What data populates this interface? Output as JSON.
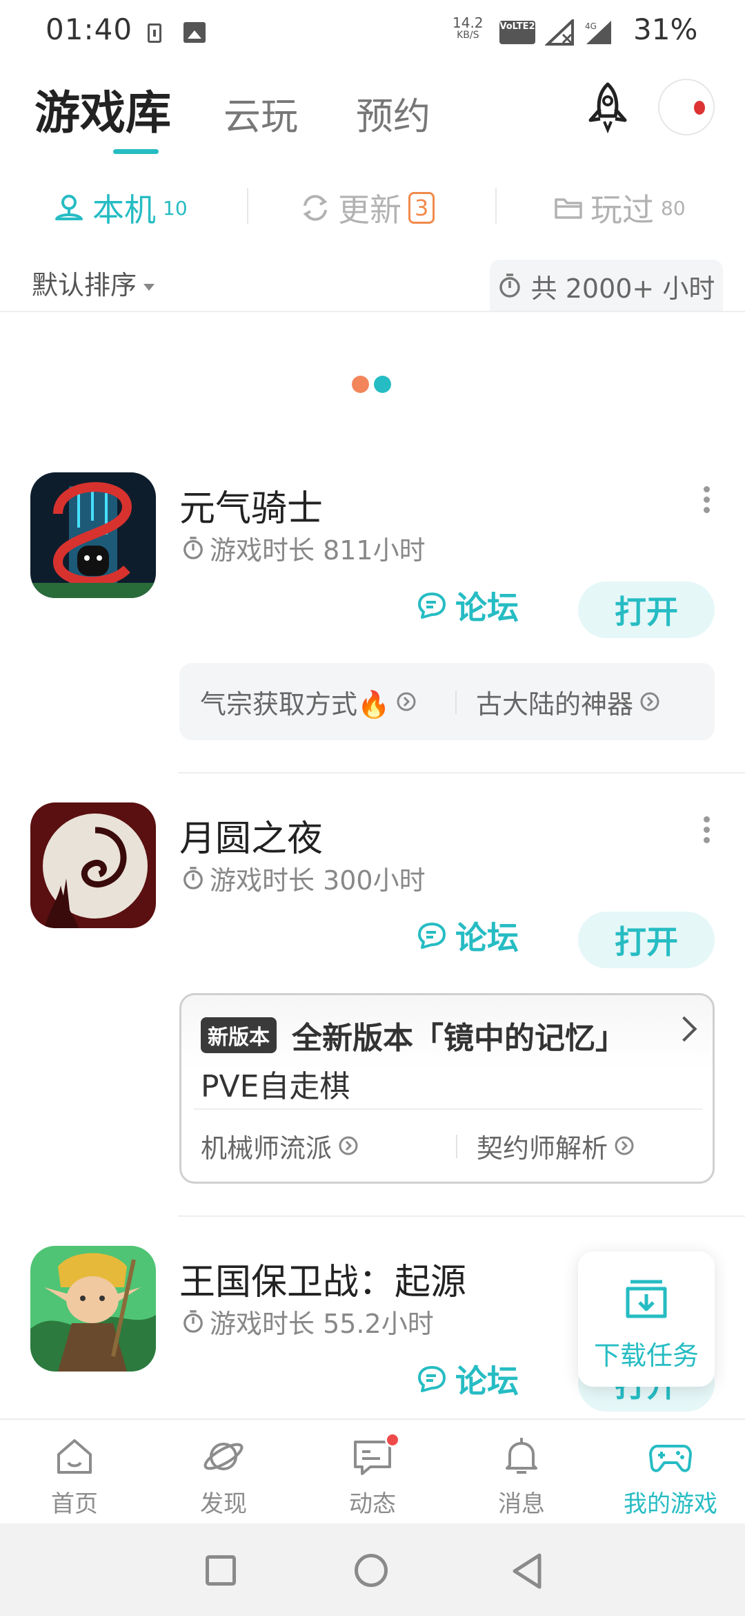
{
  "status_bar": {
    "time": "01:40",
    "net_speed": "14.2",
    "net_speed_unit": "KB/S",
    "volte": "VoLTE2",
    "network": "4G",
    "battery": "31%"
  },
  "top_tabs": [
    {
      "label": "游戏库",
      "active": true
    },
    {
      "label": "云玩",
      "active": false
    },
    {
      "label": "预约",
      "active": false
    }
  ],
  "sub_tabs": [
    {
      "label": "本机",
      "count": "10",
      "icon": "device-icon",
      "active": true
    },
    {
      "label": "更新",
      "count": "3",
      "icon": "refresh-icon",
      "active": false
    },
    {
      "label": "玩过",
      "count": "80",
      "icon": "folder-icon",
      "active": false
    }
  ],
  "sort": {
    "label": "默认排序"
  },
  "total_hours": "共 2000+ 小时",
  "games": [
    {
      "name": "元气骑士",
      "playtime": "游戏时长 811小时",
      "forum_label": "论坛",
      "open_label": "打开",
      "links": [
        "气宗获取方式🔥",
        "古大陆的神器"
      ]
    },
    {
      "name": "月圆之夜",
      "playtime": "游戏时长 300小时",
      "forum_label": "论坛",
      "open_label": "打开",
      "version": {
        "badge": "新版本",
        "title": "全新版本「镜中的记忆」",
        "subtitle": "PVE自走棋"
      },
      "links": [
        "机械师流派",
        "契约师解析"
      ]
    },
    {
      "name": "王国保卫战：起源",
      "playtime": "游戏时长 55.2小时",
      "forum_label": "论坛",
      "open_label": "打开"
    }
  ],
  "download_tasks": {
    "label": "下载任务"
  },
  "bottom_nav": [
    {
      "label": "首页",
      "icon": "home-icon",
      "active": false
    },
    {
      "label": "发现",
      "icon": "planet-icon",
      "active": false
    },
    {
      "label": "动态",
      "icon": "message-icon",
      "active": false,
      "badge": true
    },
    {
      "label": "消息",
      "icon": "bell-icon",
      "active": false
    },
    {
      "label": "我的游戏",
      "icon": "gamepad-icon",
      "active": true
    }
  ],
  "colors": {
    "accent": "#26bcc3",
    "accent_light": "#e6f7f8",
    "update_badge": "#f08a4b",
    "loader_orange": "#f2865a",
    "loader_teal": "#26bcc3",
    "notify_red": "#ef4a4a"
  }
}
